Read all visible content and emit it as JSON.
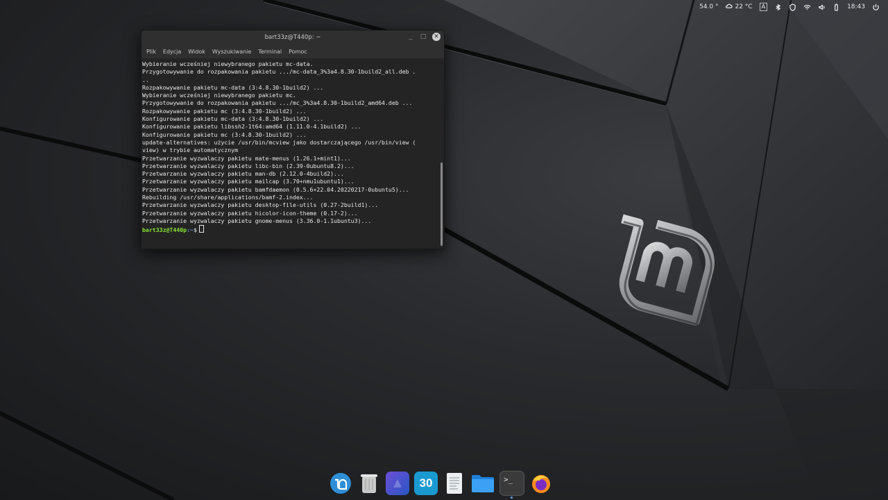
{
  "tray": {
    "cpu_temp": "54.0 °",
    "weather_temp": "22 °C",
    "keyboard_layout": "A",
    "clock": "18:43"
  },
  "terminal": {
    "title": "bart33z@T440p: ~",
    "menu": [
      "Plik",
      "Edycja",
      "Widok",
      "Wyszukiwanie",
      "Terminal",
      "Pomoc"
    ],
    "lines": [
      "Wybieranie wcześniej niewybranego pakietu mc-data.",
      "Przygotowywanie do rozpakowania pakietu .../mc-data_3%3a4.8.30-1build2_all.deb .",
      "..",
      "Rozpakowywanie pakietu mc-data (3:4.8.30-1build2) ...",
      "Wybieranie wcześniej niewybranego pakietu mc.",
      "Przygotowywanie do rozpakowania pakietu .../mc_3%3a4.8.30-1build2_amd64.deb ...",
      "Rozpakowywanie pakietu mc (3:4.8.30-1build2) ...",
      "Konfigurowanie pakietu mc-data (3:4.8.30-1build2) ...",
      "Konfigurowanie pakietu libssh2-1t64:amd64 (1.11.0-4.1build2) ...",
      "Konfigurowanie pakietu mc (3:4.8.30-1build2) ...",
      "update-alternatives: użycie /usr/bin/mcview jako dostarczającego /usr/bin/view (",
      "view) w trybie automatycznym",
      "Przetwarzanie wyzwalaczy pakietu mate-menus (1.26.1+mint1)...",
      "Przetwarzanie wyzwalaczy pakietu libc-bin (2.39-0ubuntu8.2)...",
      "Przetwarzanie wyzwalaczy pakietu man-db (2.12.0-4build2)...",
      "Przetwarzanie wyzwalaczy pakietu mailcap (3.70+nmu1ubuntu1)...",
      "Przetwarzanie wyzwalaczy pakietu bamfdaemon (0.5.6+22.04.20220217-0ubuntu5)...",
      "Rebuilding /usr/share/applications/bamf-2.index...",
      "Przetwarzanie wyzwalaczy pakietu desktop-file-utils (0.27-2build1)...",
      "Przetwarzanie wyzwalaczy pakietu hicolor-icon-theme (0.17-2)...",
      "Przetwarzanie wyzwalaczy pakietu gnome-menus (3.36.0-1.1ubuntu3)..."
    ],
    "prompt_user": "bart33z@T440p",
    "prompt_path": ":~",
    "prompt_symbol": "$"
  },
  "dock": {
    "calendar_day": "30",
    "apps": [
      "mintmenu-icon",
      "trash-icon",
      "graphics-icon",
      "calendar-icon",
      "text-editor-icon",
      "files-icon",
      "terminal-icon",
      "firefox-icon"
    ]
  },
  "colors": {
    "prompt_user": "#8ae234",
    "prompt_path": "#729fcf",
    "accent": "#5aa9ff"
  }
}
